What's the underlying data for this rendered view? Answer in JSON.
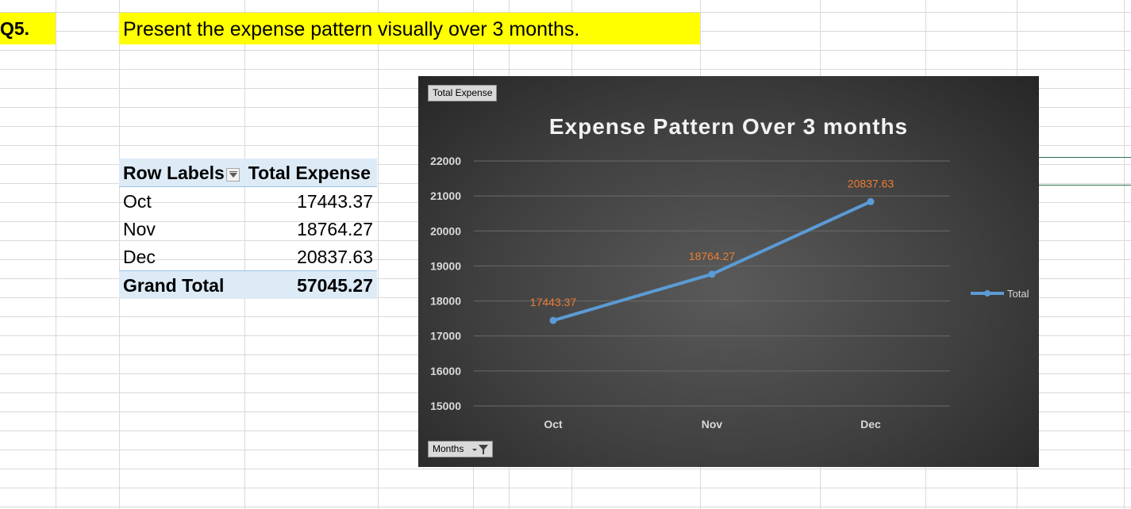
{
  "question": {
    "label": "Q5.",
    "text": "Present the expense pattern visually over 3 months."
  },
  "pivot": {
    "header_label": "Row Labels",
    "header_value": "Total Expense",
    "rows": [
      {
        "label": "Oct",
        "value": "17443.37"
      },
      {
        "label": "Nov",
        "value": "18764.27"
      },
      {
        "label": "Dec",
        "value": "20837.63"
      }
    ],
    "total_label": "Grand Total",
    "total_value": "57045.27"
  },
  "chart": {
    "field_button_value": "Total Expense",
    "field_button_axis": "Months",
    "colors": {
      "line": "#5b9bd5",
      "data_label": "#ed7d31",
      "tick": "#d9d9d9"
    }
  },
  "chart_data": {
    "type": "line",
    "title": "Expense Pattern Over 3 months",
    "xlabel": "",
    "ylabel": "",
    "categories": [
      "Oct",
      "Nov",
      "Dec"
    ],
    "series": [
      {
        "name": "Total",
        "values": [
          17443.37,
          18764.27,
          20837.63
        ]
      }
    ],
    "data_labels": [
      "17443.37",
      "18764.27",
      "20837.63"
    ],
    "ylim": [
      15000,
      22000
    ],
    "yticks": [
      "15000",
      "16000",
      "17000",
      "18000",
      "19000",
      "20000",
      "21000",
      "22000"
    ],
    "grid": true,
    "legend": "right"
  }
}
